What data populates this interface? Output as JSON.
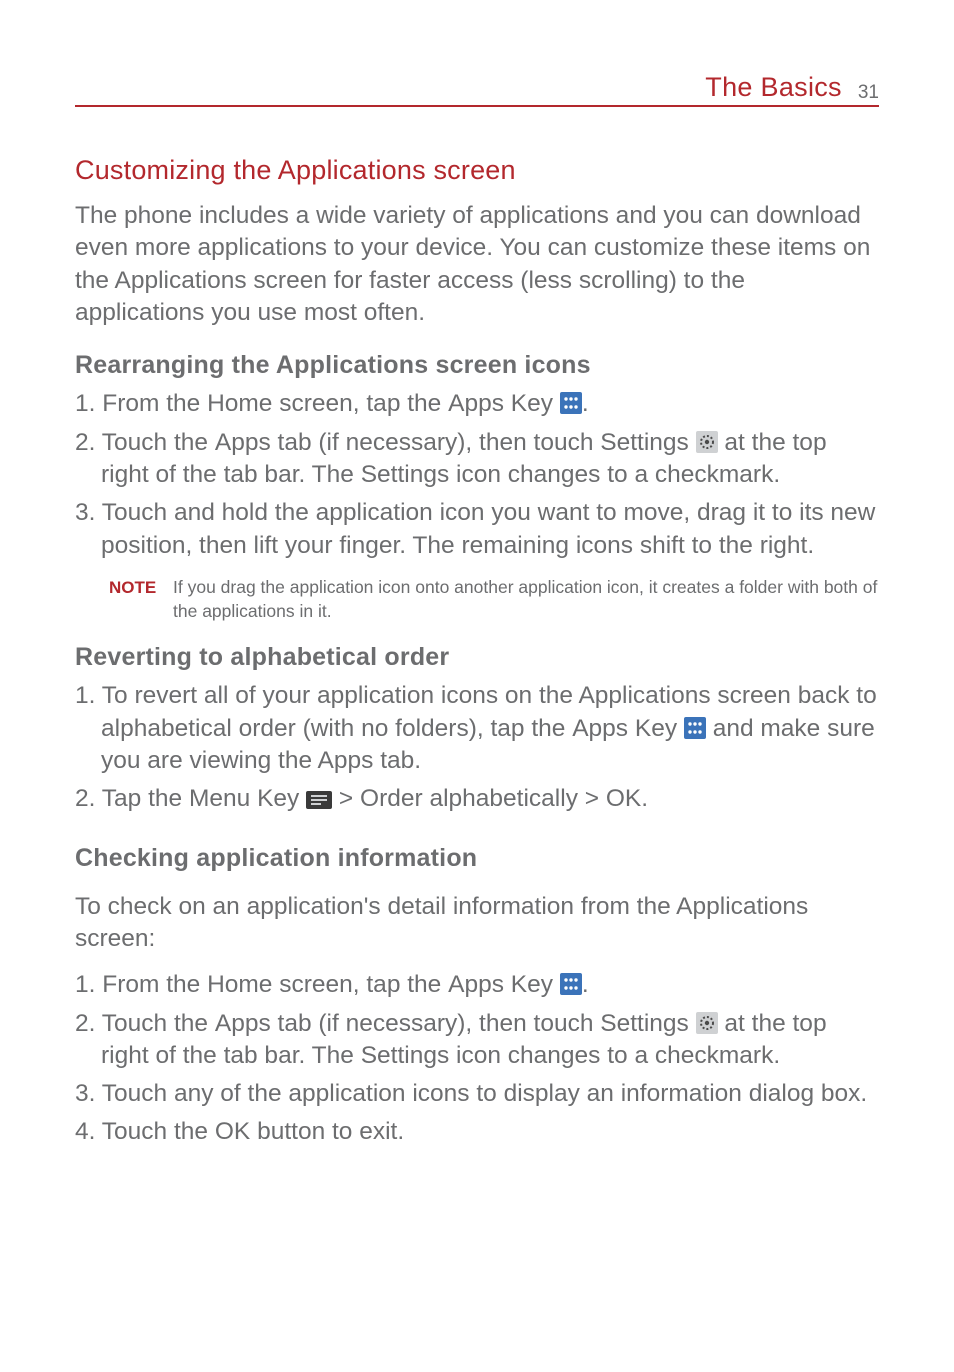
{
  "header": {
    "section": "The Basics",
    "page": "31"
  },
  "s1": {
    "title": "Customizing the Applications screen",
    "p": "The phone includes a wide variety of applications and you can download even more applications to your device. You can customize these items on the Applications screen for faster access (less scrolling) to the applications you use most often."
  },
  "s2": {
    "title": "Rearranging the Applications screen icons",
    "i1a": "1. From the Home screen, tap the ",
    "i1b": "Apps Key",
    "i1c": ".",
    "i2a": "2. Touch the ",
    "i2b": "Apps",
    "i2c": " tab (if necessary), then touch Settings ",
    "i2d": " at the top right of the tab bar. The Settings icon changes to a checkmark.",
    "i3": "3. Touch and hold the application icon you want to move, drag it to its new position, then lift your finger. The remaining icons shift to the right.",
    "noteLabel": "NOTE",
    "note": "If you drag the application icon onto another application icon, it creates a folder with both of the applications in it."
  },
  "s3": {
    "title": "Reverting to alphabetical order",
    "i1a": "1. To revert all of your application icons on the Applications screen back to alphabetical order (with no folders), tap the ",
    "i1b": "Apps Key",
    "i1c": " and make sure you are viewing the Apps tab.",
    "i2a": "2. Tap the ",
    "i2b": "Menu Key",
    "i2c": " > ",
    "i2d": "Order alphabetically",
    "i2e": " > ",
    "i2f": "OK",
    "i2g": "."
  },
  "s4": {
    "title": "Checking application information",
    "p": "To check on an application's detail information from the Applications screen:",
    "i1a": "1.  From the Home screen, tap the ",
    "i1b": "Apps Key",
    "i1c": ".",
    "i2a": "2.  Touch the ",
    "i2b": "Apps",
    "i2c": " tab (if necessary), then touch Settings ",
    "i2d": " at the top right of the tab bar. The Settings icon changes to a checkmark.",
    "i3": "3.  Touch any of the application icons to display an information dialog box.",
    "i4a": "4.  Touch the ",
    "i4b": "OK",
    "i4c": " button to exit."
  }
}
